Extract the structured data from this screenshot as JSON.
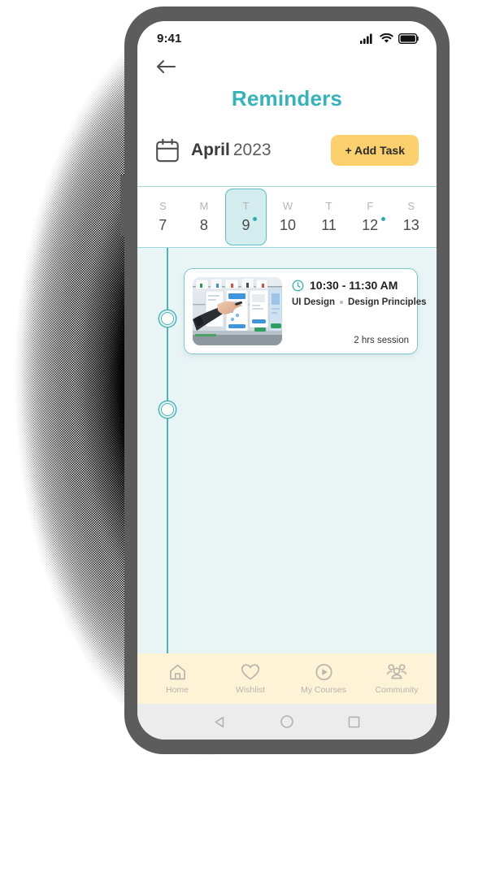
{
  "status_bar": {
    "time": "9:41",
    "icons": [
      "cellular-signal-icon",
      "wifi-icon",
      "battery-icon"
    ]
  },
  "header": {
    "back_icon": "back-arrow-icon",
    "title": "Reminders",
    "calendar_icon": "calendar-icon",
    "month": "April",
    "year": "2023",
    "add_task_label": "+ Add Task"
  },
  "week_strip": {
    "days": [
      {
        "letter": "S",
        "date": "7",
        "selected": false,
        "has_dot": false
      },
      {
        "letter": "M",
        "date": "8",
        "selected": false,
        "has_dot": false
      },
      {
        "letter": "T",
        "date": "9",
        "selected": true,
        "has_dot": true
      },
      {
        "letter": "W",
        "date": "10",
        "selected": false,
        "has_dot": false
      },
      {
        "letter": "T",
        "date": "11",
        "selected": false,
        "has_dot": false
      },
      {
        "letter": "F",
        "date": "12",
        "selected": false,
        "has_dot": true
      },
      {
        "letter": "S",
        "date": "13",
        "selected": false,
        "has_dot": false
      }
    ]
  },
  "timeline": {
    "node_count": 2,
    "task": {
      "thumbnail_alt": "ui-wireframes-whiteboard-photo",
      "clock_icon": "clock-icon",
      "time_range": "10:30 - 11:30 AM",
      "subject": "UI Design",
      "topic": "Design Principles",
      "duration": "2 hrs session"
    }
  },
  "bottom_nav": {
    "items": [
      {
        "label": "Home",
        "icon": "home-icon"
      },
      {
        "label": "Wishlist",
        "icon": "heart-icon"
      },
      {
        "label": "My Courses",
        "icon": "play-circle-icon"
      },
      {
        "label": "Community",
        "icon": "community-people-icon"
      }
    ]
  },
  "android_nav": {
    "back": "android-back-triangle-icon",
    "home": "android-home-circle-icon",
    "recents": "android-recents-square-icon"
  },
  "colors": {
    "accent_teal": "#34b3b8",
    "timeline_teal": "#4cb4ba",
    "selected_day_bg": "#d3ecee",
    "button_yellow": "#fbd06d",
    "body_bg": "#e9f4f5",
    "nav_bg": "#fdf3d7",
    "frame_gray": "#5c5c5c"
  }
}
